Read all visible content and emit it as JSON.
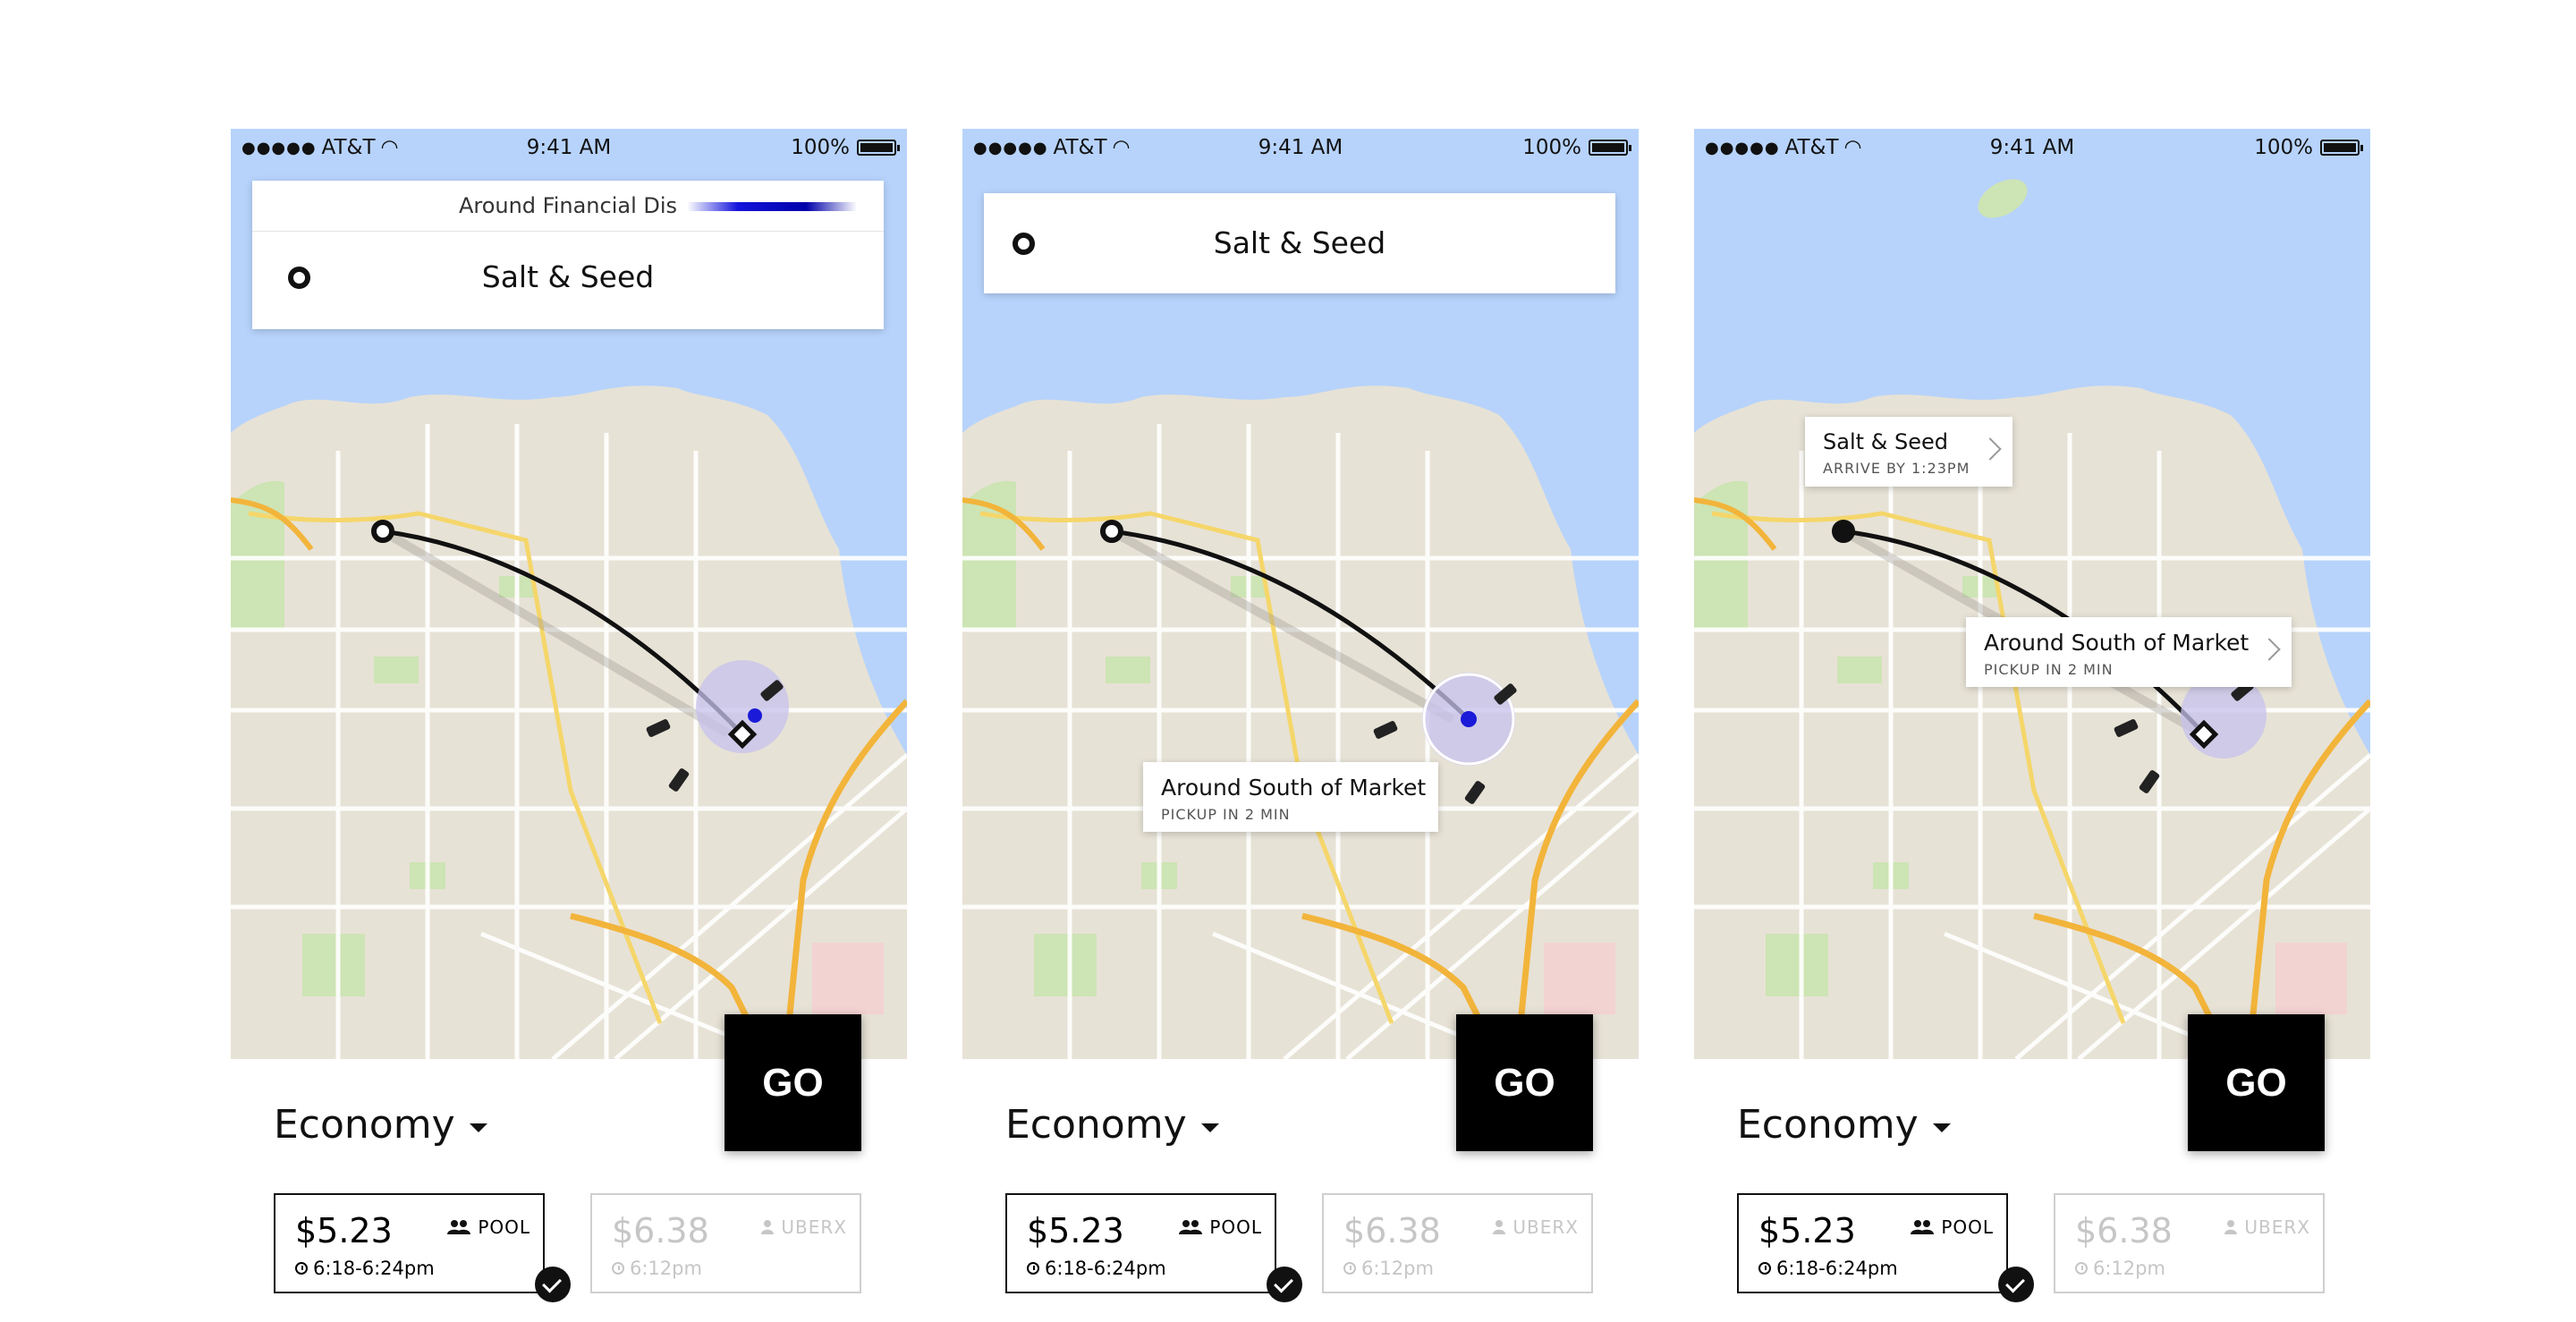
{
  "status_bar": {
    "carrier": "AT&T",
    "time": "9:41 AM",
    "battery": "100%"
  },
  "colors": {
    "water": "#b7d3fb",
    "land": "#e7e2d6",
    "route": "#111111",
    "pickup_halo": "#c7c2ec",
    "pickup_dot": "#1a1ad8"
  },
  "screens": [
    {
      "search_subtitle": "Around Financial Dis",
      "destination": "Salt & Seed",
      "go_label": "GO"
    },
    {
      "destination": "Salt & Seed",
      "pickup_tooltip": {
        "title": "Around South of Market",
        "subtitle": "PICKUP IN 2 MIN"
      },
      "go_label": "GO"
    },
    {
      "destination_tooltip": {
        "title": "Salt & Seed",
        "subtitle": "ARRIVE BY 1:23PM"
      },
      "pickup_tooltip": {
        "title": "Around South of Market",
        "subtitle": "PICKUP IN 2 MIN"
      },
      "go_label": "GO"
    }
  ],
  "product": {
    "tier": "Economy",
    "options": [
      {
        "price": "$5.23",
        "type": "POOL",
        "eta": "6:18-6:24pm",
        "selected": true
      },
      {
        "price": "$6.38",
        "type": "UBERX",
        "eta": "6:12pm",
        "selected": false
      }
    ]
  }
}
